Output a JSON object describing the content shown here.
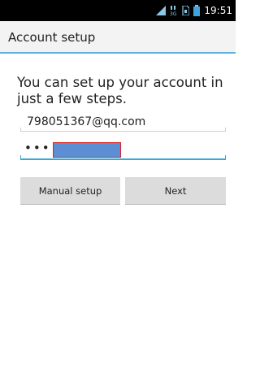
{
  "status_bar": {
    "time": "19:51",
    "icons": [
      "signal-icon",
      "3g-data-icon",
      "sim-icon",
      "battery-icon"
    ]
  },
  "header": {
    "title": "Account setup"
  },
  "intro": {
    "text": "You can set up your account in just a few steps."
  },
  "form": {
    "email_value": "798051367@qq.com",
    "password_value": "•••"
  },
  "buttons": {
    "manual_setup": "Manual setup",
    "next": "Next"
  },
  "colors": {
    "accent": "#36a7d8",
    "title_rule": "#5fb1da",
    "mask_fill": "#5b8ed2",
    "mask_border": "#e02020"
  }
}
